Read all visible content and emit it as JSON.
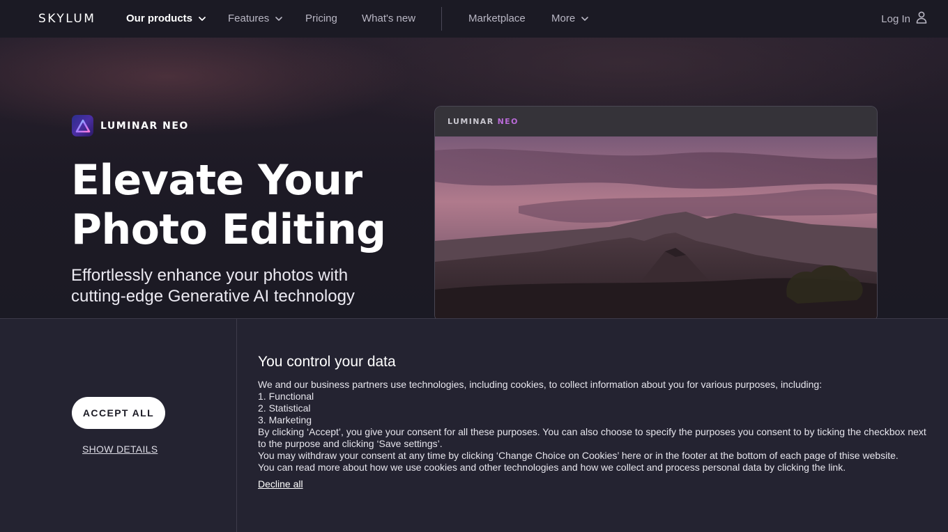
{
  "nav": {
    "logo": "SKYLUM",
    "items": [
      {
        "label": "Our products",
        "dropdown": true,
        "active": true
      },
      {
        "label": "Features",
        "dropdown": true,
        "active": false
      },
      {
        "label": "Pricing",
        "dropdown": false,
        "active": false
      },
      {
        "label": "What's new",
        "dropdown": false,
        "active": false
      },
      {
        "label": "Marketplace",
        "dropdown": false,
        "active": false
      },
      {
        "label": "More",
        "dropdown": true,
        "active": false
      }
    ],
    "login_label": "Log In",
    "login_icon": "user-icon"
  },
  "hero": {
    "brand_name": "LUMINAR NEO",
    "brand_icon": "luminar-neo-logo",
    "headline_line1": "Elevate Your",
    "headline_line2": "Photo Editing",
    "subhead_line1": "Effortlessly enhance your photos with",
    "subhead_line2": "cutting-edge Generative AI technology"
  },
  "preview": {
    "title_main": "LUMINAR",
    "title_accent": "NEO",
    "accent_color": "#b96ad8",
    "image_description_icon": "mountain-landscape-image"
  },
  "consent": {
    "accept_label": "ACCEPT ALL",
    "details_label": "SHOW DETAILS",
    "title": "You control your data",
    "intro": "We and our business partners use technologies, including cookies, to collect information about you for various purposes, including:",
    "purposes": [
      "1. Functional",
      "2. Statistical",
      "3. Marketing"
    ],
    "p1": "By clicking ‘Accept’, you give your consent for all these purposes. You can also choose to specify the purposes you consent to by ticking the checkbox next to the purpose and clicking ‘Save settings’.",
    "p2": "You may withdraw your consent at any time by clicking ‘Change Choice on Cookies’ here or in the footer at the bottom of each page of thise website.",
    "p3": "You can read more about how we use cookies and other technologies and how we collect and process personal data by clicking the link.",
    "decline_label": "Decline all"
  }
}
